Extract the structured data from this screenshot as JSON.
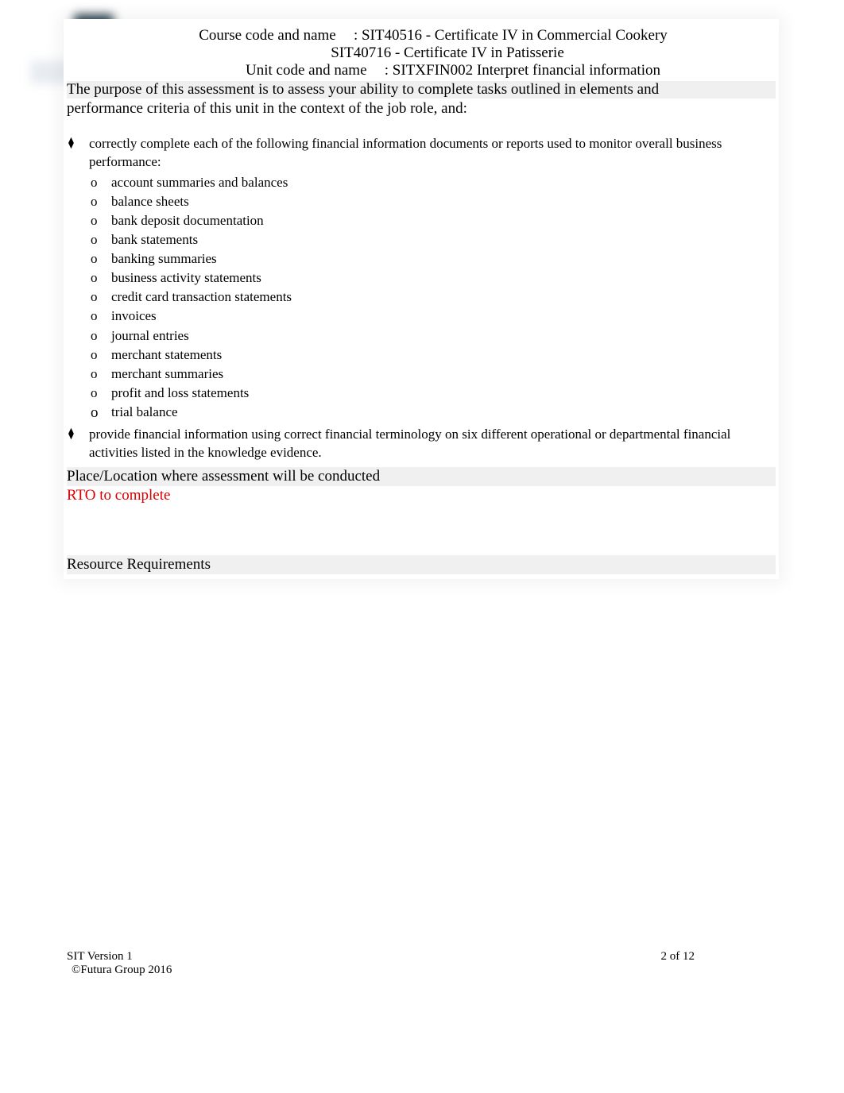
{
  "header": {
    "course_label": "Course code and name",
    "course_value1": ": SIT40516 - Certificate IV in Commercial Cookery",
    "course_value2": "SIT40716 - Certificate IV in Patisserie",
    "unit_label": "Unit code and name",
    "unit_value": ": SITXFIN002 Interpret financial information"
  },
  "purpose": {
    "intro": "The purpose of this assessment is to assess your ability to complete tasks outlined in elements and performance criteria of this unit in the context of the job role, and:"
  },
  "bullets": {
    "b1": "correctly complete each of the following financial information documents or reports used to monitor overall business performance:",
    "b2": "provide financial information using correct financial terminology on six different operational or departmental financial activities listed in the knowledge evidence."
  },
  "sub_items": [
    "account summaries and balances",
    "balance sheets",
    "bank deposit documentation",
    "bank statements",
    "banking summaries",
    "business activity statements",
    "credit card transaction statements",
    "invoices",
    "journal entries",
    "merchant statements",
    "merchant summaries",
    "profit and loss statements",
    "trial balance"
  ],
  "place_label": "Place/Location where assessment will be conducted",
  "rto_text": "RTO to complete",
  "resource_label": "Resource Requirements",
  "footer": {
    "version": "SIT Version 1",
    "page": "2 of 12",
    "copyright": "©Futura Group 2016"
  }
}
